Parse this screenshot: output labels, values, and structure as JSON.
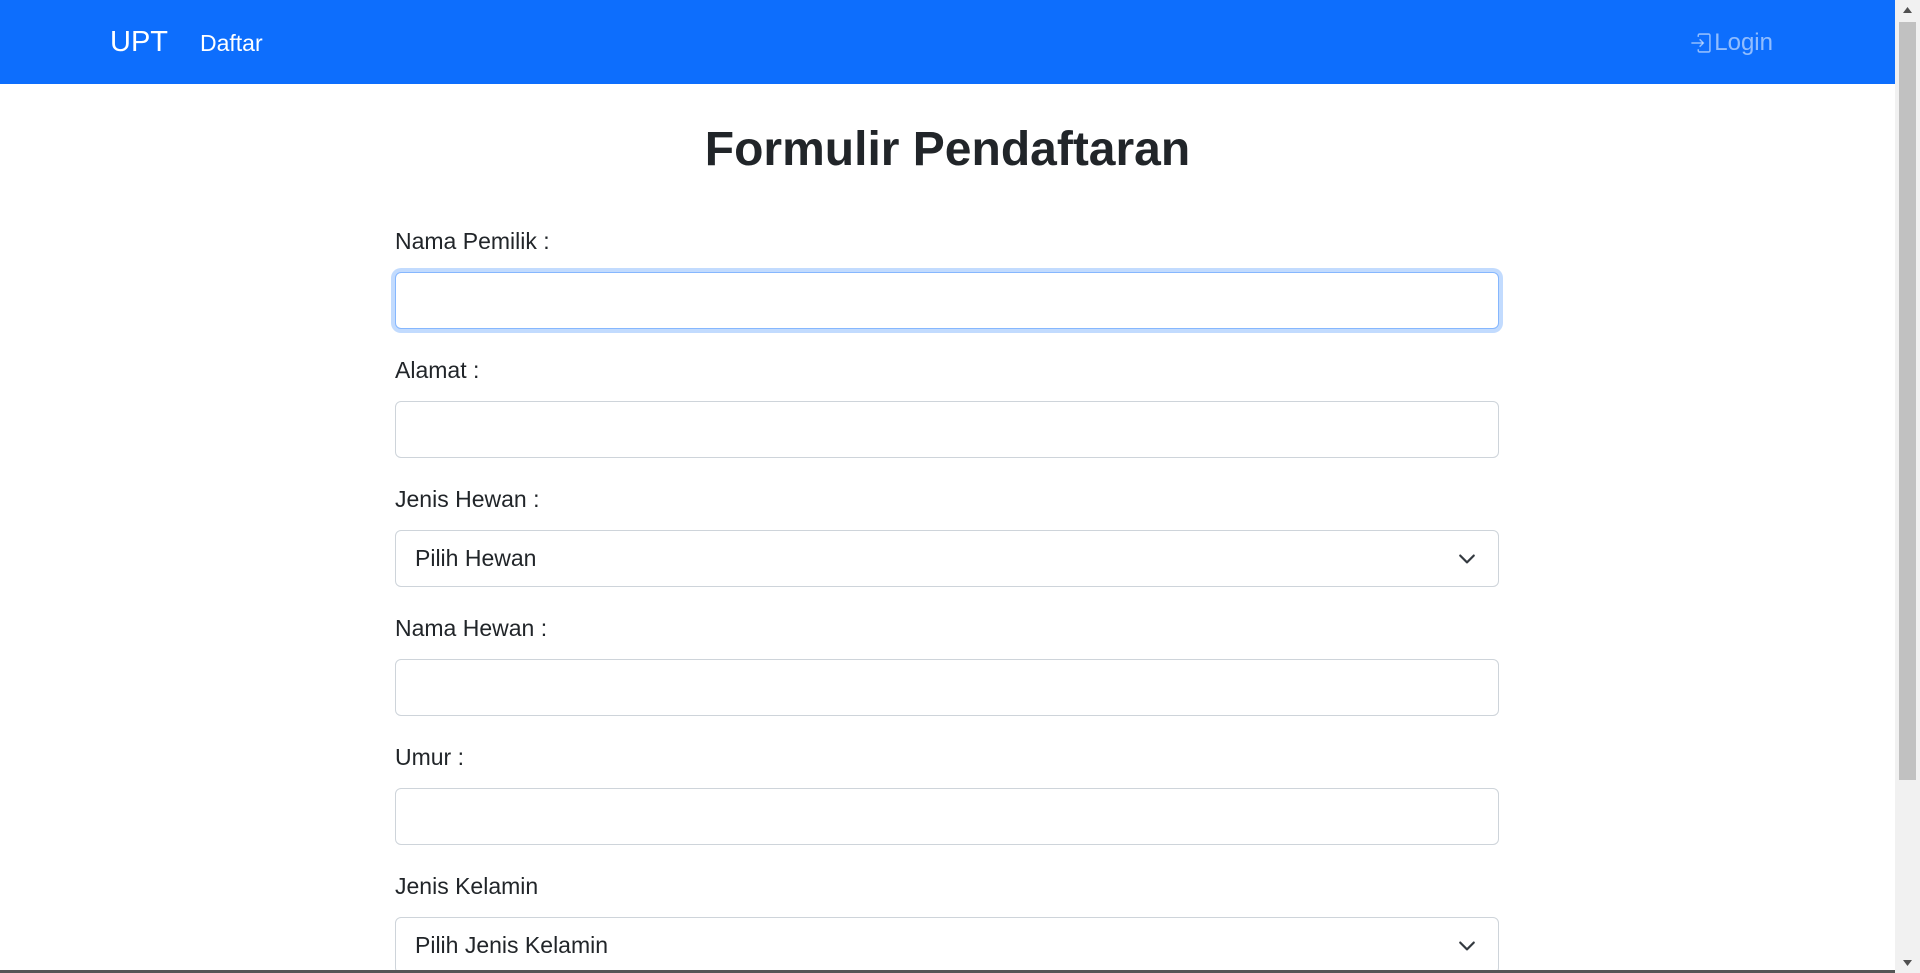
{
  "navbar": {
    "brand": "UPT",
    "links": [
      {
        "label": "Daftar"
      }
    ],
    "login_label": "Login",
    "login_icon": "box-arrow-in-right-icon",
    "background": "#0d6efd"
  },
  "page": {
    "title": "Formulir Pendaftaran"
  },
  "form": {
    "fields": [
      {
        "label": "Nama Pemilik :",
        "type": "text",
        "value": "",
        "focused": true
      },
      {
        "label": "Alamat :",
        "type": "text",
        "value": ""
      },
      {
        "label": "Jenis Hewan :",
        "type": "select",
        "value": "Pilih Hewan"
      },
      {
        "label": "Nama Hewan :",
        "type": "text",
        "value": ""
      },
      {
        "label": "Umur :",
        "type": "text",
        "value": ""
      },
      {
        "label": "Jenis Kelamin",
        "type": "select",
        "value": "Pilih Jenis Kelamin"
      }
    ]
  },
  "colors": {
    "accent": "#0d6efd",
    "focus_border": "#86b7fe",
    "input_border": "#ced4da",
    "text": "#212529"
  }
}
